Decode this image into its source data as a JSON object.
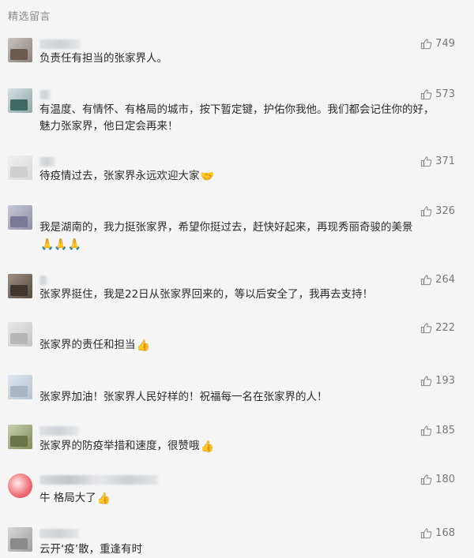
{
  "section": {
    "title": "精选留言"
  },
  "comments": [
    {
      "likes": "749",
      "text": "负责任有担当的张家界人。",
      "emoji": ""
    },
    {
      "likes": "573",
      "text": "有温度、有情怀、有格局的城市，按下暂定键，护佑你我他。我们都会记住你的好，魅力张家界，他日定会再来！",
      "emoji": ""
    },
    {
      "likes": "371",
      "text": "待疫情过去，张家界永远欢迎大家",
      "emoji": "🤝"
    },
    {
      "likes": "326",
      "text": "我是湖南的，我力挺张家界，希望你挺过去，赶快好起来，再现秀丽奇骏的美景",
      "emoji": "🙏🙏🙏"
    },
    {
      "likes": "264",
      "text": "张家界挺住，我是22日从张家界回来的，等以后安全了，我再去支持！",
      "emoji": ""
    },
    {
      "likes": "222",
      "text": "张家界的责任和担当",
      "emoji": "👍"
    },
    {
      "likes": "193",
      "text": "张家界加油！张家界人民好样的！祝福每一名在张家界的人！",
      "emoji": ""
    },
    {
      "likes": "185",
      "text": "张家界的防疫举措和速度，很赞哦",
      "emoji": "👍"
    },
    {
      "likes": "180",
      "text": "牛 格局大了",
      "emoji": "👍"
    },
    {
      "likes": "168",
      "text": "云开‘疫’散，重逢有时",
      "emoji": ""
    }
  ],
  "icons": {
    "like": "thumbs-up-icon"
  },
  "colors": {
    "background": "#f5f5f5",
    "text": "#2b2b2b",
    "muted": "#8c8c8c"
  }
}
